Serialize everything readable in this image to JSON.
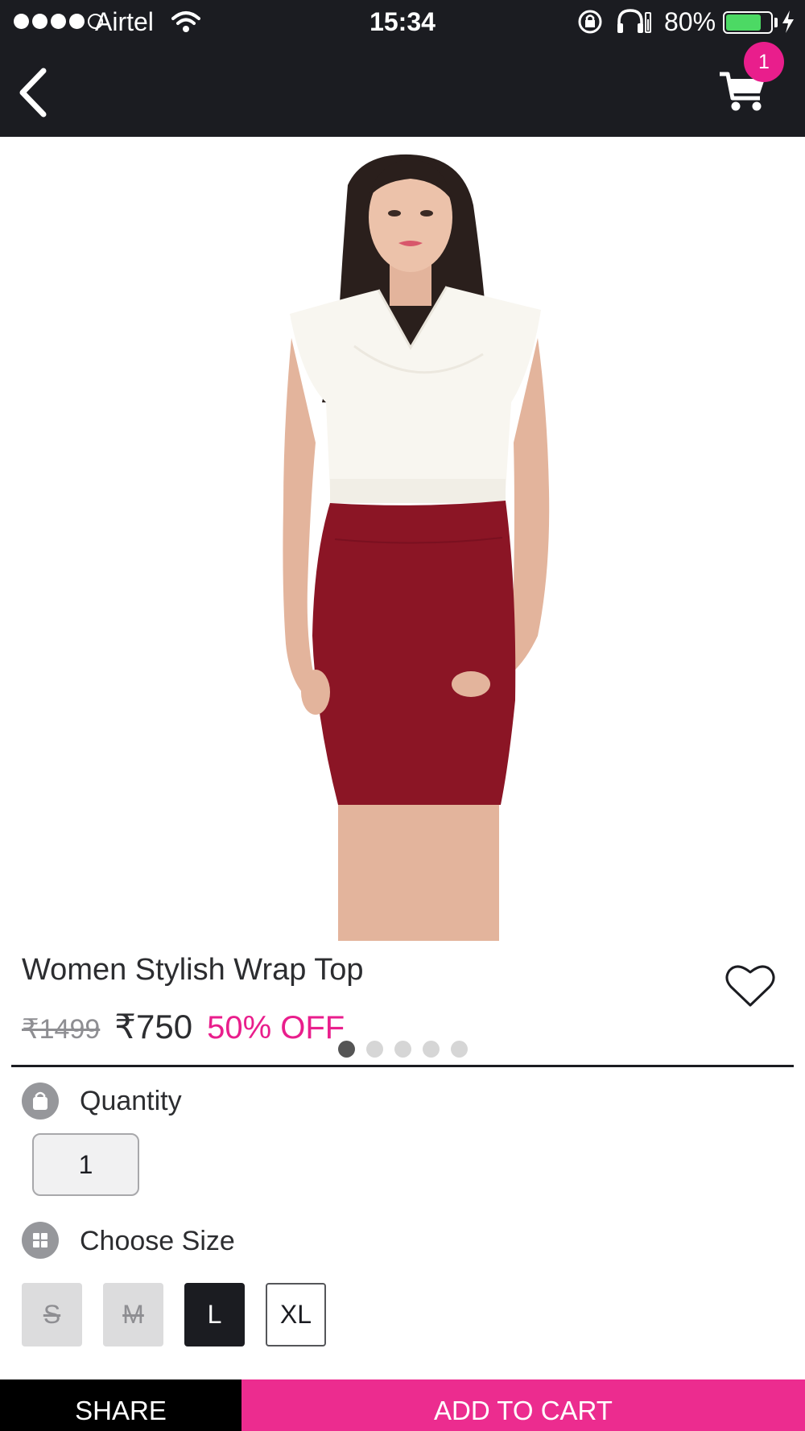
{
  "status_bar": {
    "carrier": "Airtel",
    "time": "15:34",
    "battery_percent": "80%",
    "battery_level": 0.8,
    "signal_bars": 4
  },
  "header": {
    "back_icon": "chevron-left-icon",
    "cart_icon": "cart-icon",
    "cart_count": "1"
  },
  "gallery": {
    "image_count": 5,
    "active_index": 0
  },
  "product": {
    "title": "Women Stylish Wrap Top",
    "mrp": "₹1499",
    "price": "₹750",
    "discount": "50% OFF",
    "wishlist_icon": "heart-icon"
  },
  "quantity": {
    "label": "Quantity",
    "value": "1",
    "icon": "shopping-bag-icon"
  },
  "size": {
    "label": "Choose Size",
    "icon": "grid-icon",
    "options": [
      {
        "label": "S",
        "state": "unavailable"
      },
      {
        "label": "M",
        "state": "unavailable"
      },
      {
        "label": "L",
        "state": "selected"
      },
      {
        "label": "XL",
        "state": "available"
      }
    ]
  },
  "actions": {
    "share_label": "SHARE",
    "add_to_cart_label": "ADD TO CART"
  },
  "colors": {
    "brand_pink": "#e91e8c",
    "header_dark": "#1b1c21"
  }
}
